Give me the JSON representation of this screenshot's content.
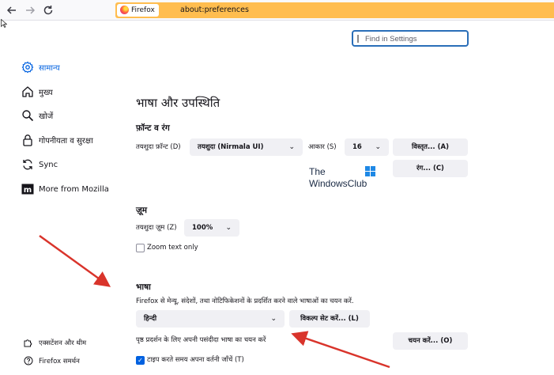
{
  "browser": {
    "identity_label": "Firefox",
    "url": "about:preferences"
  },
  "search": {
    "placeholder": "Find in Settings"
  },
  "sidebar": {
    "items": [
      {
        "label": "सामान्य",
        "icon": "gear-icon",
        "active": true
      },
      {
        "label": "मुख्य",
        "icon": "home-icon"
      },
      {
        "label": "खोजें",
        "icon": "search-icon"
      },
      {
        "label": "गोपनीयता व सुरक्षा",
        "icon": "lock-icon"
      },
      {
        "label": "Sync",
        "icon": "sync-icon"
      },
      {
        "label": "More from Mozilla",
        "icon": "mozilla-icon"
      }
    ],
    "footer": [
      {
        "label": "एक्सटेंशन और थीम",
        "icon": "puzzle-icon"
      },
      {
        "label": "Firefox समर्थन",
        "icon": "help-icon"
      }
    ]
  },
  "main": {
    "section_title": "भाषा और उपस्थिति",
    "fonts": {
      "heading": "फ़ॉन्ट व रंग",
      "default_font_label": "तयशुदा फ़ॉन्ट (D)",
      "default_font_value": "तयशुदा (Nirmala UI)",
      "size_label": "आकार (S)",
      "size_value": "16",
      "advanced_button": "विस्तृत... (A)",
      "colors_button": "रंग... (C)"
    },
    "zoom": {
      "heading": "ज़ूम",
      "default_zoom_label": "तयशुदा ज़ूम (Z)",
      "default_zoom_value": "100%",
      "zoom_text_only": "Zoom text only"
    },
    "language": {
      "heading": "भाषा",
      "description": "Firefox से मेन्यू, संदेशों, तथा नोटिफिकेशनों के प्रदर्शित करने वाले भाषाओं का चयन करें.",
      "language_value": "हिन्दी",
      "alternatives_button": "विकल्प सेट करें... (L)",
      "page_language_label": "पृष्ठ प्रदर्शन के लिए अपनी पसंदीदा भाषा का चयन करें",
      "choose_button": "चयन करें... (O)",
      "spellcheck_label": "टाइप करते समय अपना वर्तनी जाँचें (T)"
    }
  },
  "watermark": {
    "line1": "The",
    "line2": "WindowsClub"
  },
  "colors": {
    "accent": "#0061e0",
    "urlbar": "#ffbd4f",
    "arrow": "#d9342b"
  }
}
